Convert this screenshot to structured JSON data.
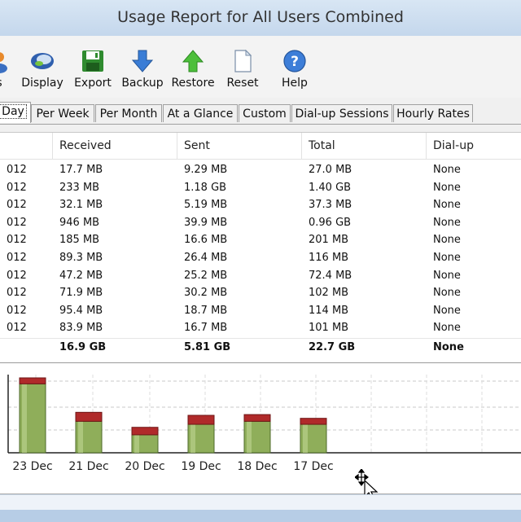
{
  "window": {
    "title": "Usage Report for All Users Combined"
  },
  "toolbar": {
    "items": [
      {
        "label": "s",
        "icon": "users-icon"
      },
      {
        "label": "Display",
        "icon": "display-icon"
      },
      {
        "label": "Export",
        "icon": "floppy-disk-icon"
      },
      {
        "label": "Backup",
        "icon": "arrow-down-icon"
      },
      {
        "label": "Restore",
        "icon": "arrow-up-icon"
      },
      {
        "label": "Reset",
        "icon": "blank-page-icon"
      },
      {
        "label": "Help",
        "icon": "help-icon"
      }
    ]
  },
  "tabs": [
    "Day",
    "Per Week",
    "Per Month",
    "At a Glance",
    "Custom",
    "Dial-up Sessions",
    "Hourly Rates"
  ],
  "active_tab": "Day",
  "table": {
    "columns": [
      "",
      "Received",
      "Sent",
      "Total",
      "Dial-up"
    ],
    "rows": [
      [
        "012",
        "17.7 MB",
        "9.29 MB",
        "27.0 MB",
        "None"
      ],
      [
        "012",
        "233 MB",
        "1.18 GB",
        "1.40 GB",
        "None"
      ],
      [
        "012",
        "32.1 MB",
        "5.19 MB",
        "37.3 MB",
        "None"
      ],
      [
        "012",
        "946 MB",
        "39.9 MB",
        "0.96 GB",
        "None"
      ],
      [
        "012",
        "185 MB",
        "16.6 MB",
        "201 MB",
        "None"
      ],
      [
        "012",
        "89.3 MB",
        "26.4 MB",
        "116 MB",
        "None"
      ],
      [
        "012",
        "47.2 MB",
        "25.2 MB",
        "72.4 MB",
        "None"
      ],
      [
        "012",
        "71.9 MB",
        "30.2 MB",
        "102 MB",
        "None"
      ],
      [
        "012",
        "95.4 MB",
        "18.7 MB",
        "114 MB",
        "None"
      ],
      [
        "012",
        "83.9 MB",
        "16.7 MB",
        "101 MB",
        "None"
      ]
    ],
    "total": [
      "",
      "16.9 GB",
      "5.81 GB",
      "22.7 GB",
      "None"
    ]
  },
  "chart_data": {
    "type": "bar",
    "categories": [
      "23 Dec",
      "21 Dec",
      "20 Dec",
      "19 Dec",
      "18 Dec",
      "17 Dec"
    ],
    "series": [
      {
        "values": [
          0.92,
          0.42,
          0.24,
          0.38,
          0.42,
          0.38
        ],
        "color": "#8fae5a"
      },
      {
        "values": [
          0.08,
          0.12,
          0.1,
          0.12,
          0.09,
          0.08
        ],
        "color": "#b02a2a"
      }
    ],
    "grid": true,
    "unit": "relative height (no axis labels shown)"
  }
}
